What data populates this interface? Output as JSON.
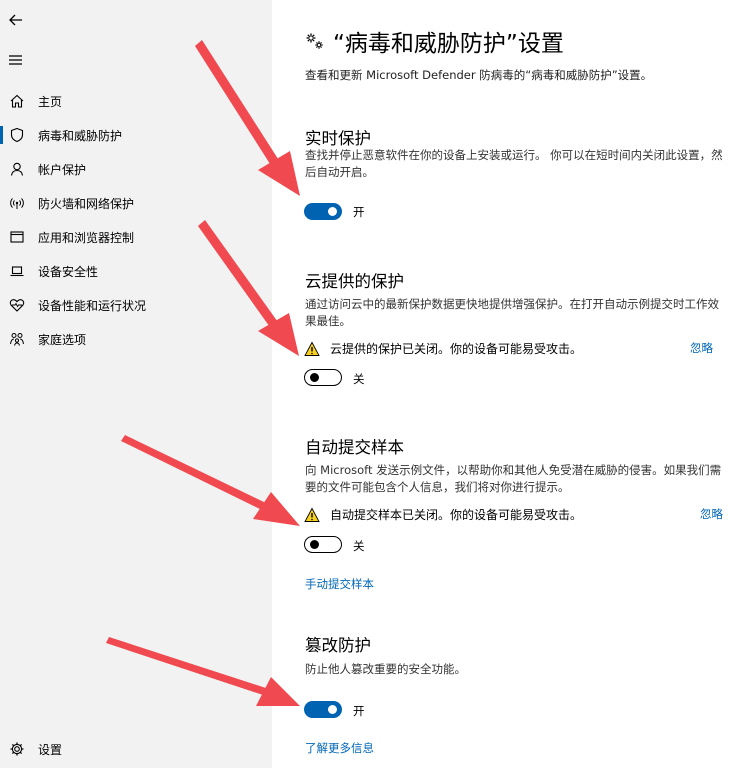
{
  "sidebar": {
    "items": [
      {
        "label": "主页",
        "icon": "home-icon"
      },
      {
        "label": "病毒和威胁防护",
        "icon": "shield-icon"
      },
      {
        "label": "帐户保护",
        "icon": "person-icon"
      },
      {
        "label": "防火墙和网络保护",
        "icon": "wifi-icon"
      },
      {
        "label": "应用和浏览器控制",
        "icon": "window-icon"
      },
      {
        "label": "设备安全性",
        "icon": "laptop-icon"
      },
      {
        "label": "设备性能和运行状况",
        "icon": "heart-icon"
      },
      {
        "label": "家庭选项",
        "icon": "family-icon"
      }
    ],
    "settings_label": "设置"
  },
  "page": {
    "title": "“病毒和威胁防护”设置",
    "subtitle": "查看和更新 Microsoft Defender 防病毒的“病毒和威胁防护”设置。"
  },
  "realtime": {
    "title": "实时保护",
    "desc": "查找并停止恶意软件在你的设备上安装或运行。 你可以在短时间内关闭此设置，然后自动开启。",
    "toggle_label": "开"
  },
  "cloud": {
    "title": "云提供的保护",
    "desc": "通过访问云中的最新保护数据更快地提供增强保护。在打开自动示例提交时工作效果最佳。",
    "warning": "云提供的保护已关闭。你的设备可能易受攻击。",
    "ignore": "忽略",
    "toggle_label": "关"
  },
  "sample": {
    "title": "自动提交样本",
    "desc": "向 Microsoft 发送示例文件，以帮助你和其他人免受潜在威胁的侵害。如果我们需要的文件可能包含个人信息，我们将对你进行提示。",
    "warning": "自动提交样本已关闭。你的设备可能易受攻击。",
    "ignore": "忽略",
    "toggle_label": "关",
    "manual_link": "手动提交样本"
  },
  "tamper": {
    "title": "篡改防护",
    "desc": "防止他人篡改重要的安全功能。",
    "toggle_label": "开",
    "learn_more": "了解更多信息"
  },
  "colors": {
    "accent": "#0063b1",
    "link": "#0067b8",
    "sidebar_bg": "#f2f2f2",
    "arrow": "#f0494f",
    "warning_fill": "#f7d11d"
  }
}
